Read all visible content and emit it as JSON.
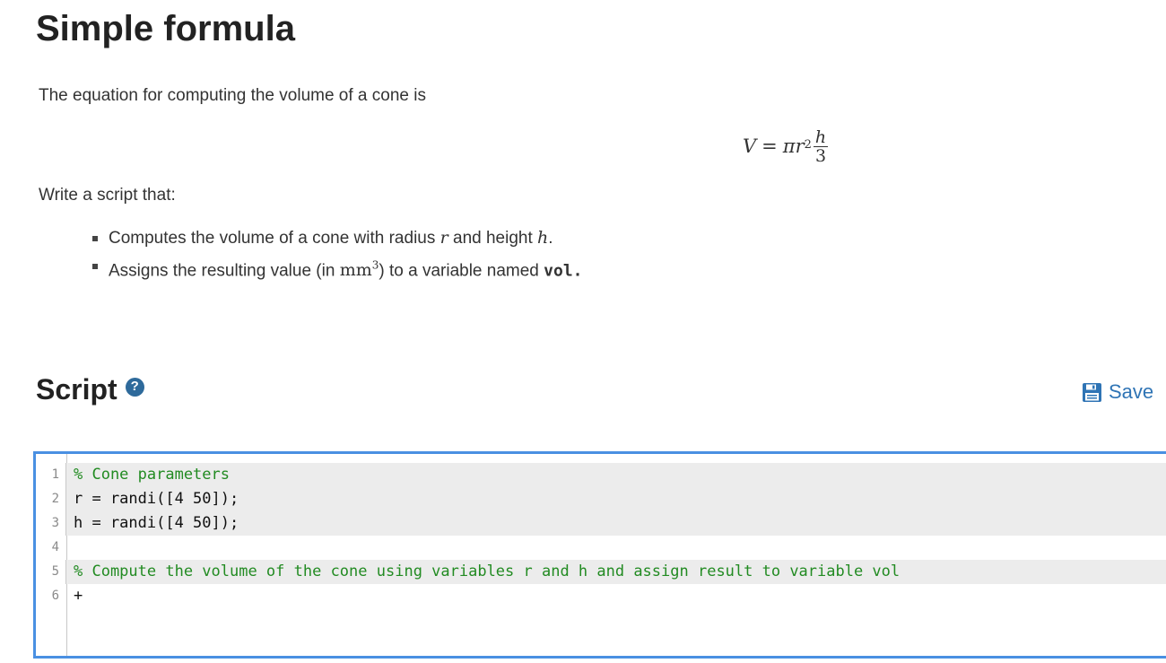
{
  "title": "Simple formula",
  "intro": "The equation for computing the volume of a cone is",
  "equation": {
    "lhs": "V",
    "equals": "=",
    "pi": "π",
    "r": "r",
    "exponent": "2",
    "numerator": "h",
    "denominator": "3"
  },
  "write_label": "Write a script that:",
  "bullets": [
    {
      "before": "Computes the volume of a cone with radius",
      "var1": "r",
      "middle": "and height",
      "var2": "h",
      "end": "."
    },
    {
      "before": "Assigns the resulting value (in",
      "unit": "mm",
      "unit_exp": "3",
      "after": ") to a variable named",
      "varname": "vol."
    }
  ],
  "script_heading": "Script",
  "help_icon": {
    "glyph": "?",
    "name": "help-icon"
  },
  "save_label": "Save",
  "colors": {
    "accent": "#2f74b5",
    "editor_border": "#4a90e2",
    "comment": "#228b22"
  },
  "editor": {
    "lines": [
      {
        "number": "1",
        "text": "% Cone parameters"
      },
      {
        "number": "2",
        "text": "r = randi([4 50]);"
      },
      {
        "number": "3",
        "text": "h = randi([4 50]);"
      },
      {
        "number": "4",
        "text": ""
      },
      {
        "number": "5",
        "text": "% Compute the volume of the cone using variables r and h and assign result to variable vol"
      },
      {
        "number": "6",
        "text": "+"
      }
    ]
  }
}
